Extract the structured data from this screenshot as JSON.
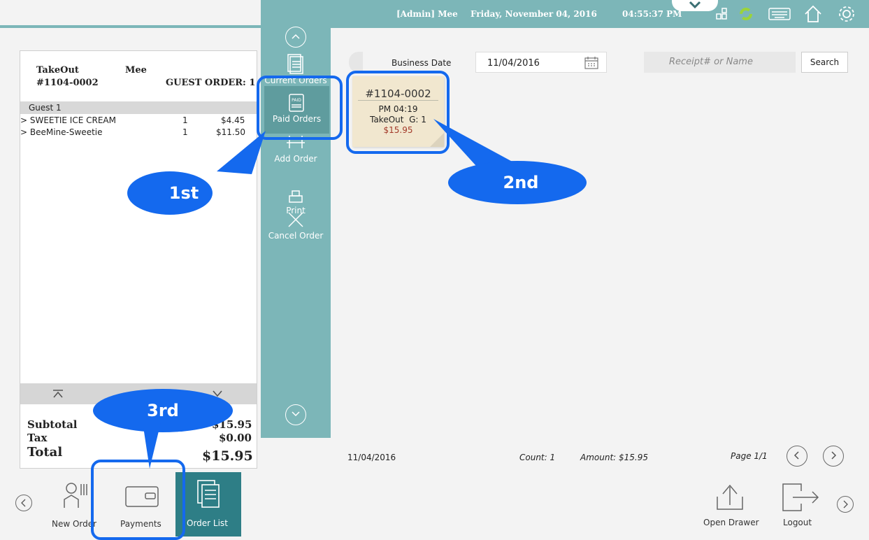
{
  "topbar": {
    "user": "[Admin] Mee",
    "date": "Friday, November 04, 2016",
    "time": "04:55:37 PM"
  },
  "receipt": {
    "order_type": "TakeOut",
    "server": "Mee",
    "order_no": "#1104-0002",
    "guest_order": "GUEST ORDER: 1",
    "guest_label": "Guest 1",
    "items": [
      {
        "name": "> SWEETIE ICE CREAM",
        "qty": "1",
        "price": "$4.45"
      },
      {
        "name": "> BeeMine-Sweetie",
        "qty": "1",
        "price": "$11.50"
      }
    ],
    "subtotal_label": "Subtotal",
    "subtotal": "$15.95",
    "tax_label": "Tax",
    "tax": "$0.00",
    "total_label": "Total",
    "total": "$15.95"
  },
  "sidebar": {
    "current_orders": "Current Orders",
    "paid_orders": "Paid Orders",
    "add_order": "Add Order",
    "print": "Print",
    "cancel_order": "Cancel Order"
  },
  "search": {
    "business_date_label": "Business Date",
    "business_date": "11/04/2016",
    "placeholder": "Receipt# or Name",
    "button": "Search"
  },
  "order_card": {
    "number": "#1104-0002",
    "time": "PM 04:19",
    "type": "TakeOut",
    "guests": "G: 1",
    "amount": "$15.95"
  },
  "footer_stats": {
    "date": "11/04/2016",
    "count": "Count: 1",
    "amount": "Amount: $15.95",
    "page": "Page 1/1"
  },
  "bottom": {
    "new_order": "New Order",
    "payments": "Payments",
    "order_list": "Order List",
    "open_drawer": "Open Drawer",
    "logout": "Logout"
  },
  "annotations": {
    "first": "1st",
    "second": "2nd",
    "third": "3rd"
  },
  "colors": {
    "teal": "#7cb6b8",
    "teal_dark": "#2e7e86",
    "callout_blue": "#1469ee",
    "card": "#f1e7cf",
    "amount_red": "#a33a2a"
  }
}
